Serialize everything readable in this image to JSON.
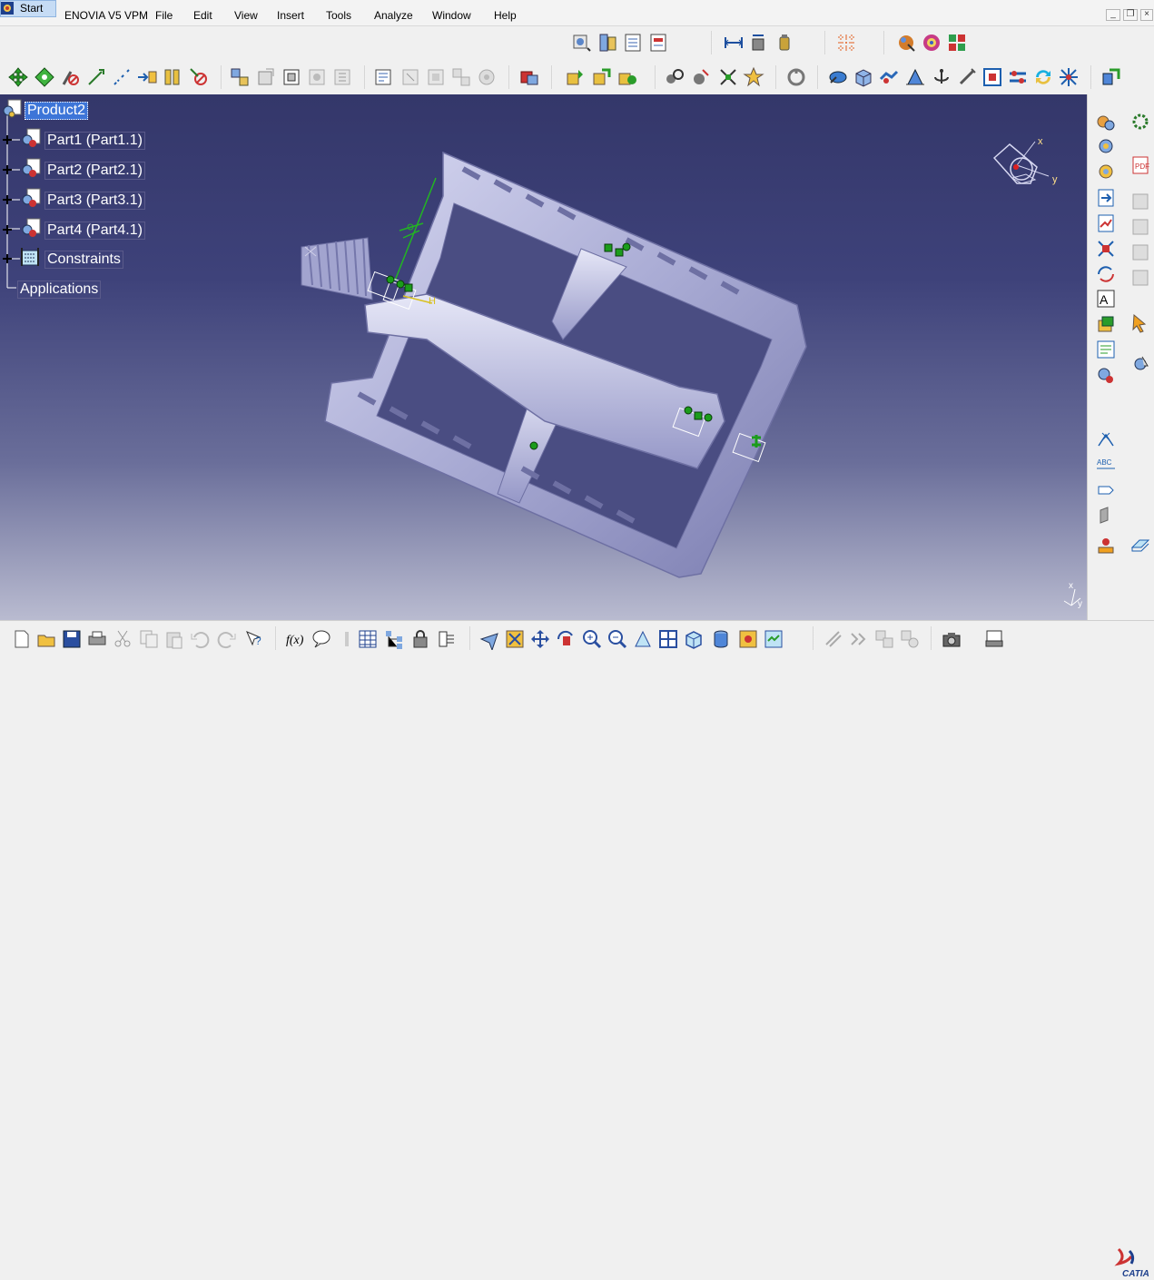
{
  "menubar": {
    "start": "Start",
    "items": [
      "ENOVIA V5 VPM",
      "File",
      "Edit",
      "View",
      "Insert",
      "Tools",
      "Analyze",
      "Window",
      "Help"
    ],
    "window_controls": [
      "minimize-icon",
      "restore-icon",
      "close-icon"
    ]
  },
  "tree": {
    "root": "Product2",
    "parts": [
      "Part1 (Part1.1)",
      "Part2 (Part2.1)",
      "Part3 (Part3.1)",
      "Part4 (Part4.1)"
    ],
    "constraints": "Constraints",
    "applications": "Applications"
  },
  "compass": {
    "x_label": "x",
    "y_label": "y"
  },
  "axis_triad": {
    "x_label": "x",
    "y_label": "y"
  },
  "anchor": {
    "h_label": "H"
  },
  "toolbar_top": {
    "icons": [
      "catalog-browser-icon",
      "product-structure-icon",
      "bom-icon",
      "scenes-icon",
      "measure-between-icon",
      "measure-item-icon",
      "measure-inertia-icon",
      "generate-numbering-icon",
      "apply-material-icon",
      "texture-icon",
      "appearance-icon"
    ]
  },
  "toolbar_second": {
    "icons": [
      "manipulation-icon",
      "snap-icon",
      "explode-icon",
      "stop-manipulation-icon",
      "smart-move-icon",
      "bill-of-material-icon",
      "fix-together-icon",
      "existing-component-icon",
      "new-component-icon",
      "new-product-icon",
      "new-part-icon",
      "replace-component-icon",
      "graph-tree-reorder-icon",
      "generate-numbering-2-icon",
      "selective-load-icon",
      "manage-representations-icon",
      "multi-instantiation-icon",
      "coincidence-constraint-icon",
      "contact-constraint-icon",
      "offset-constraint-icon",
      "angle-constraint-icon",
      "fix-component-icon",
      "fix-together-2-icon",
      "quick-constraint-icon",
      "flexible-subassembly-icon",
      "change-constraint-icon",
      "reuse-pattern-icon",
      "update-all-icon",
      "clash-icon",
      "sectioning-icon",
      "distance-band-icon",
      "compare-products-icon",
      "split-icon",
      "hole-icon",
      "pocket-icon",
      "add-icon",
      "remove-icon",
      "intersect-icon",
      "symmetry-icon",
      "translation-icon",
      "rotation-icon",
      "scale-icon"
    ]
  },
  "right_toolbar": {
    "icons": [
      "design-table-icon",
      "formula-icon",
      "knowledge-icon",
      "law-icon",
      "pdf-export-icon",
      "import-icon",
      "sketch-analysis-icon",
      "parametric-icon",
      "equation-icon",
      "check-icon",
      "text-annotation-icon",
      "part-body-icon",
      "sketch-icon",
      "select-arrow-icon",
      "gear-settings-icon",
      "datum-icon",
      "text-abc-icon",
      "flag-note-icon",
      "feature-rule-icon",
      "red-dot-icon",
      "blue-plane-icon"
    ]
  },
  "bottom_toolbar": {
    "icons": [
      "new-icon",
      "open-icon",
      "save-icon",
      "print-icon",
      "cut-icon",
      "copy-icon",
      "paste-icon",
      "undo-icon",
      "redo-icon",
      "whats-this-icon",
      "formula-fx-icon",
      "comment-icon",
      "tools-icon",
      "table-icon",
      "tree-expand-icon",
      "lock-icon",
      "edit-links-icon",
      "fly-mode-icon",
      "fit-all-icon",
      "pan-icon",
      "rotate-icon",
      "zoom-in-icon",
      "zoom-out-icon",
      "normal-view-icon",
      "multi-view-icon",
      "isometric-view-icon",
      "shading-icon",
      "hide-show-icon",
      "swap-visible-icon",
      "move-icon",
      "catalog-icon",
      "snapshot-icon",
      "capture-icon",
      "camera-icon",
      "catia-logo"
    ]
  },
  "colors": {
    "background_top": "#34376a",
    "background_bottom": "#b9bbd0",
    "tree_selected": "#3d75d8",
    "part_surface": "#b8b9e0",
    "constraint_green": "#1b9c1b"
  }
}
